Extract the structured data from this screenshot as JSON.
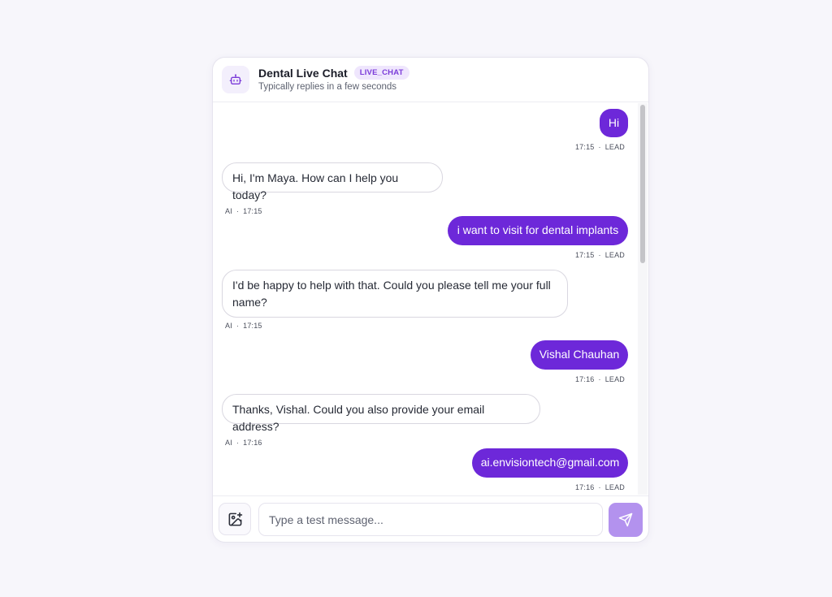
{
  "header": {
    "title": "Dental Live Chat",
    "badge": "LIVE_CHAT",
    "subtitle": "Typically replies in a few seconds"
  },
  "messages": [
    {
      "sender": "LEAD",
      "text": "Hi",
      "time": "17:15"
    },
    {
      "sender": "AI",
      "text": "Hi, I'm Maya. How can I help you today?",
      "time": "17:15"
    },
    {
      "sender": "LEAD",
      "text": "i want to visit for dental implants",
      "time": "17:15"
    },
    {
      "sender": "AI",
      "text": "I'd be happy to help with that. Could you please tell me your full name?",
      "time": "17:15"
    },
    {
      "sender": "LEAD",
      "text": "Vishal Chauhan",
      "time": "17:16"
    },
    {
      "sender": "AI",
      "text": "Thanks, Vishal. Could you also provide your email address?",
      "time": "17:16"
    },
    {
      "sender": "LEAD",
      "text": "ai.envisiontech@gmail.com",
      "time": "17:16"
    }
  ],
  "composer": {
    "placeholder": "Type a test message...",
    "value": ""
  },
  "icons": {
    "avatar": "robot-icon",
    "attach": "image-plus-icon",
    "send": "send-icon"
  },
  "colors": {
    "accent": "#6d28d9",
    "accent_light": "#b392ee",
    "badge_bg": "#efe6fd",
    "badge_text": "#7b3bd9",
    "page_bg": "#f7f6fb"
  }
}
